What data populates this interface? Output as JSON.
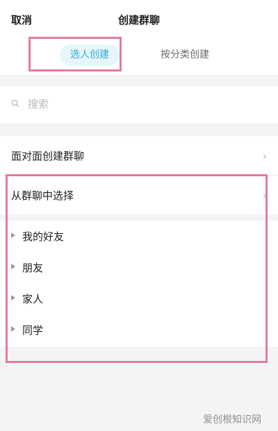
{
  "header": {
    "cancel": "取消",
    "title": "创建群聊"
  },
  "tabs": {
    "active": "选人创建",
    "inactive": "按分类创建"
  },
  "search": {
    "placeholder": "搜索"
  },
  "rows": {
    "face_to_face": "面对面创建群聊",
    "from_group": "从群聊中选择",
    "chevron": "›"
  },
  "groups": [
    "我的好友",
    "朋友",
    "家人",
    "同学"
  ],
  "watermark": "爱创根知识网",
  "colors": {
    "accent_text": "#36a8d6",
    "accent_bg": "#e6f6fb",
    "highlight": "#e57aa0"
  }
}
